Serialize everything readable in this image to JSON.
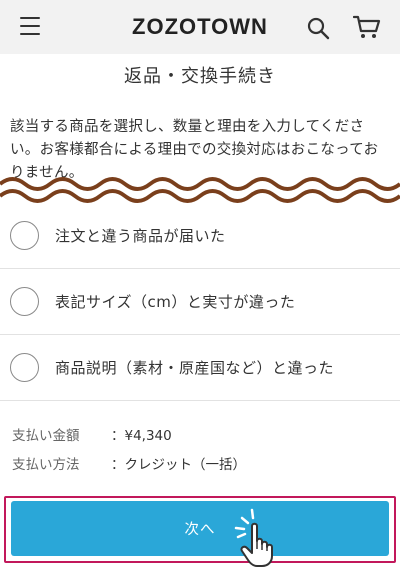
{
  "header": {
    "logo": "ZOZOTOWN",
    "icons": [
      "menu-icon",
      "search-icon",
      "cart-icon"
    ]
  },
  "page": {
    "title": "返品・交換手続き",
    "instructions": "該当する商品を選択し、数量と理由を入力してください。お客様都合による理由での交換対応はおこなっておりません。"
  },
  "reasons": [
    {
      "label": "注文と違う商品が届いた",
      "selected": false
    },
    {
      "label": "表記サイズ（cm）と実寸が違った",
      "selected": false
    },
    {
      "label": "商品説明（素材・原産国など）と違った",
      "selected": false
    }
  ],
  "payment": {
    "amount_label": "支払い金額",
    "amount_value": "：¥4,340",
    "method_label": "支払い方法",
    "method_value": "：クレジット（一括）"
  },
  "next_button": {
    "label": "次へ"
  },
  "colors": {
    "header_bg": "#f2f2f2",
    "button": "#2aa7d8",
    "highlight_frame": "#c2185b",
    "wave": "#7a3f1c"
  }
}
